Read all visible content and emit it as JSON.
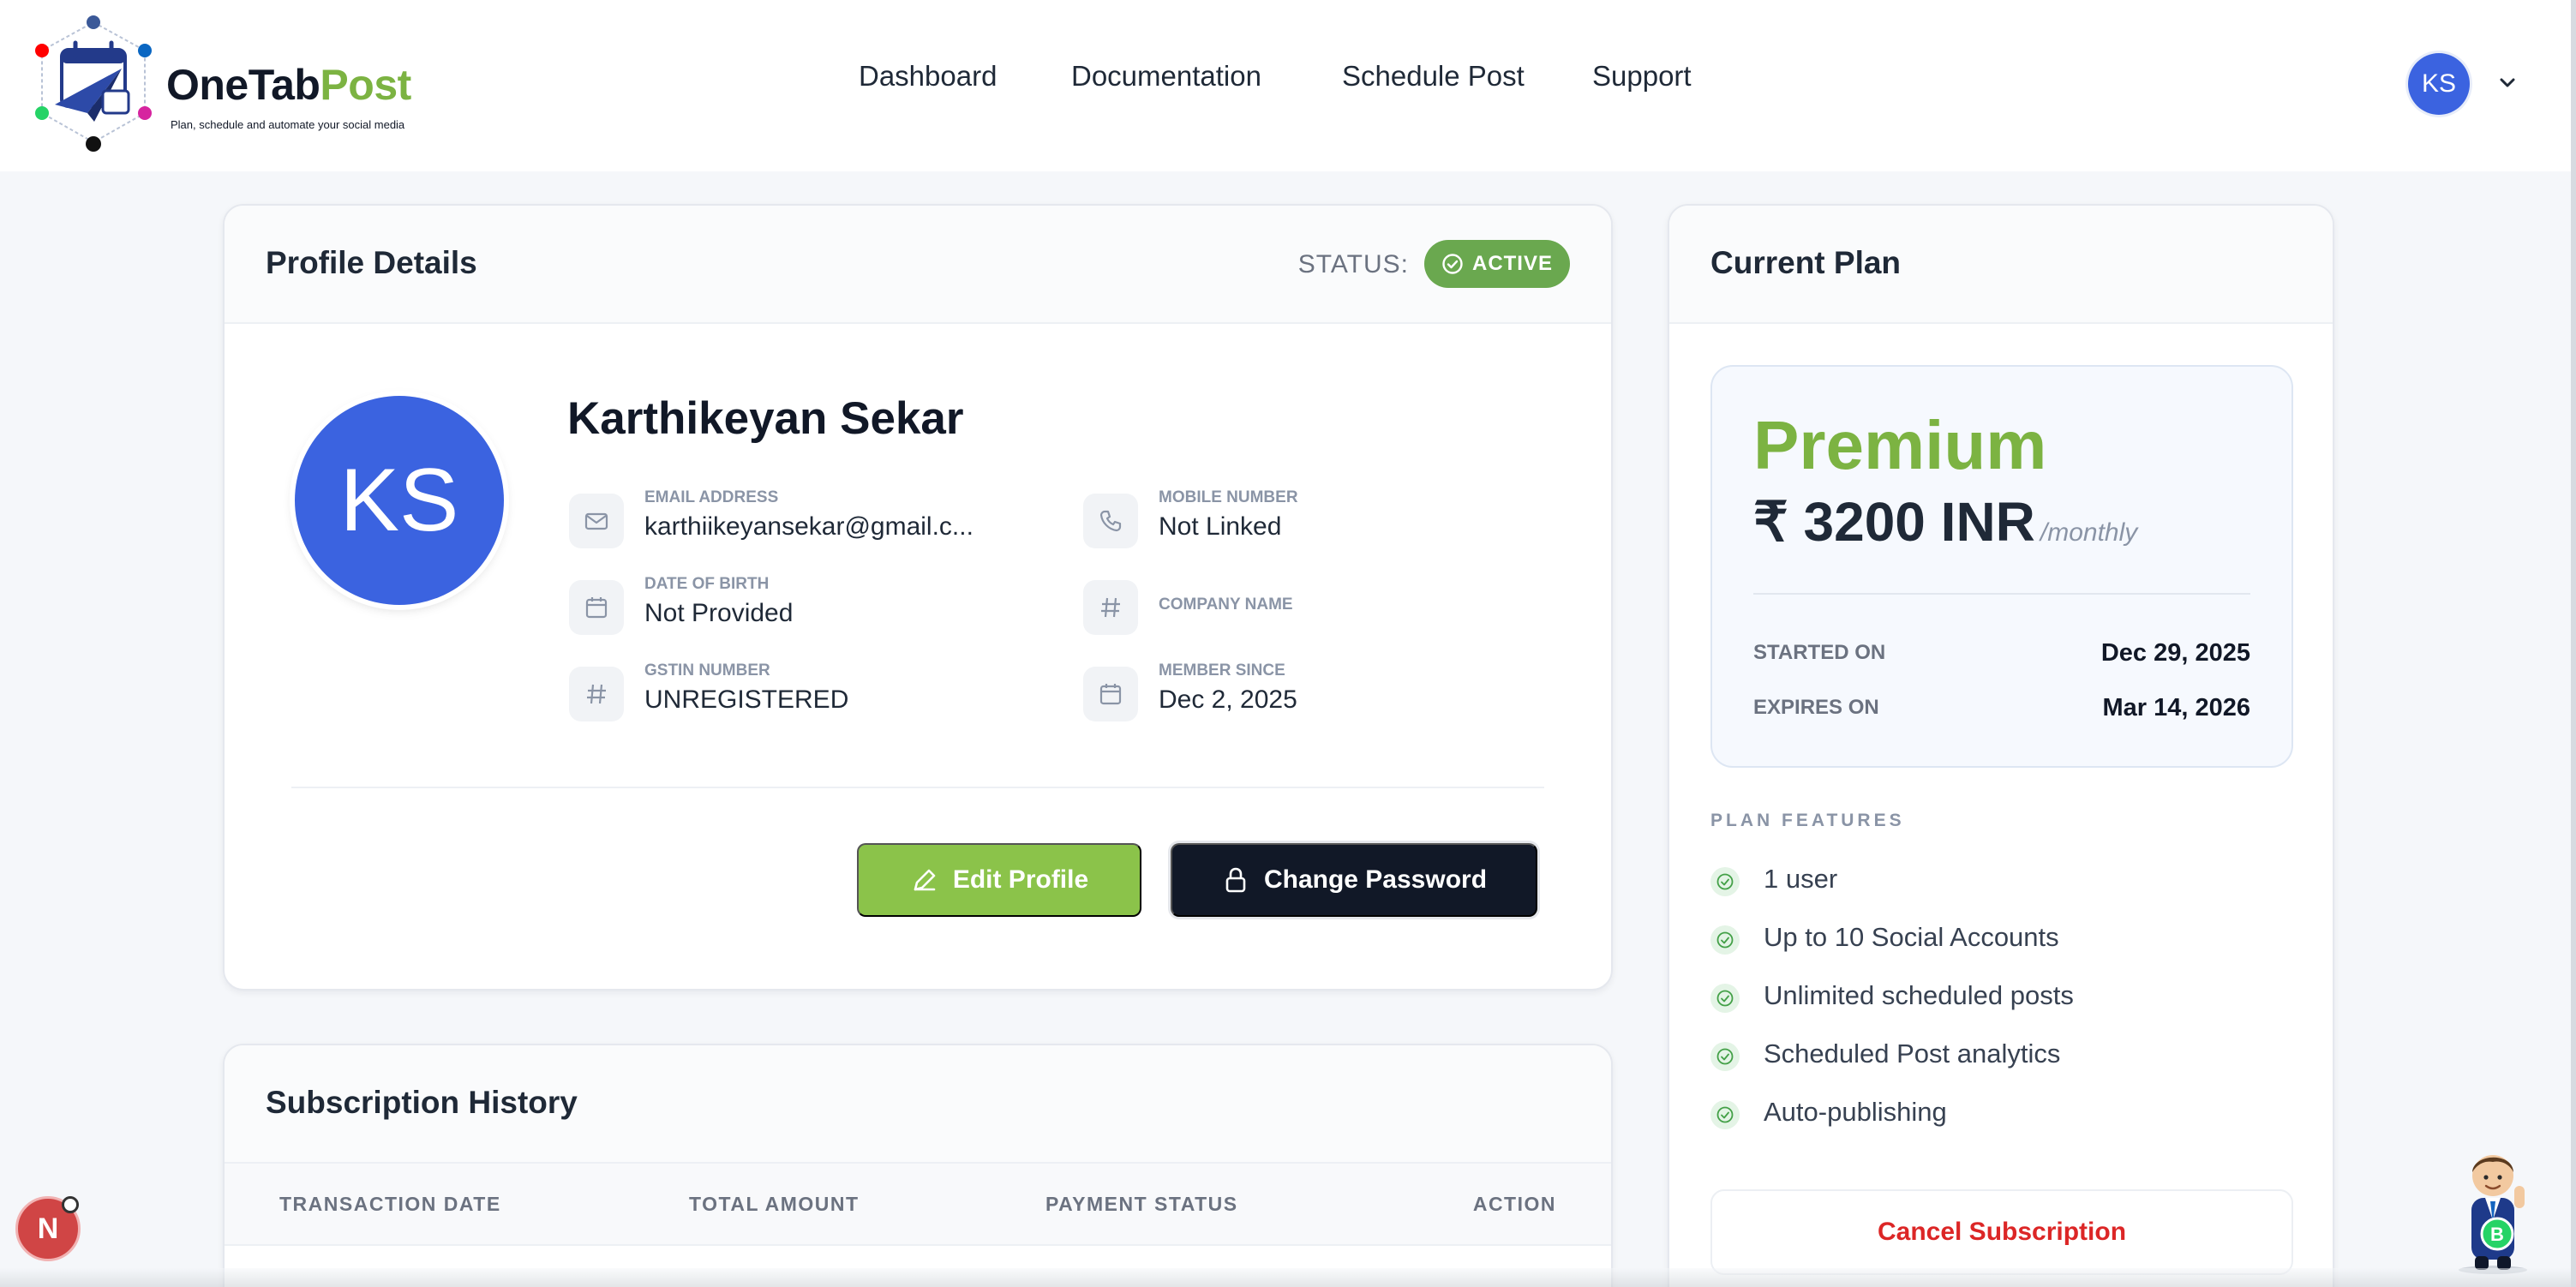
{
  "brand": {
    "name_part1": "OneTab",
    "name_part2": "Post",
    "tagline": "Plan, schedule and automate your social media",
    "accent_green": "#7cb342",
    "primary_blue": "#3b63e0"
  },
  "nav": {
    "items": [
      {
        "label": "Dashboard"
      },
      {
        "label": "Documentation"
      },
      {
        "label": "Schedule Post"
      },
      {
        "label": "Support"
      }
    ]
  },
  "user_menu": {
    "initials": "KS",
    "icon": "chevron-down-icon"
  },
  "profile": {
    "title": "Profile Details",
    "status_label": "STATUS:",
    "status_value": "ACTIVE",
    "initials": "KS",
    "name": "Karthikeyan Sekar",
    "fields": {
      "email": {
        "label": "EMAIL ADDRESS",
        "value": "karthiikeyansekar@gmail.c...",
        "icon": "mail-icon"
      },
      "mobile": {
        "label": "MOBILE NUMBER",
        "value": "Not Linked",
        "icon": "phone-icon"
      },
      "dob": {
        "label": "DATE OF BIRTH",
        "value": "Not Provided",
        "icon": "calendar-icon"
      },
      "company": {
        "label": "COMPANY NAME",
        "value": "",
        "icon": "hash-icon"
      },
      "gstin": {
        "label": "GSTIN NUMBER",
        "value": "UNREGISTERED",
        "icon": "hash-icon"
      },
      "member_since": {
        "label": "MEMBER SINCE",
        "value": "Dec 2, 2025",
        "icon": "calendar-icon"
      }
    },
    "edit_button": "Edit Profile",
    "password_button": "Change Password"
  },
  "subscription_history": {
    "title": "Subscription History",
    "columns": [
      "TRANSACTION DATE",
      "TOTAL AMOUNT",
      "PAYMENT STATUS",
      "ACTION"
    ]
  },
  "plan": {
    "title": "Current Plan",
    "name": "Premium",
    "price": "₹ 3200 INR",
    "period": "/monthly",
    "started_label": "STARTED ON",
    "started_value": "Dec 29, 2025",
    "expires_label": "EXPIRES ON",
    "expires_value": "Mar 14, 2026",
    "features_title": "PLAN FEATURES",
    "features": [
      "1 user",
      "Up to 10 Social Accounts",
      "Unlimited scheduled posts",
      "Scheduled Post analytics",
      "Auto-publishing"
    ],
    "cancel_button": "Cancel Subscription"
  },
  "widgets": {
    "dev_badge": "N"
  }
}
